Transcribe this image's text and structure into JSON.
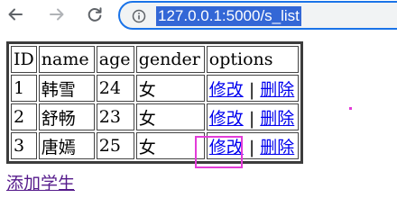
{
  "browser": {
    "url": "127.0.0.1:5000/s_list",
    "icons": {
      "back": "arrow-left-icon",
      "forward": "arrow-right-icon",
      "reload": "reload-icon",
      "site_info": "info-circle-icon"
    }
  },
  "table": {
    "headers": [
      "ID",
      "name",
      "age",
      "gender",
      "options"
    ],
    "rows": [
      {
        "id": "1",
        "name": "韩雪",
        "age": "24",
        "gender": "女",
        "edit": "修改",
        "sep": "|",
        "delete": "删除"
      },
      {
        "id": "2",
        "name": "舒畅",
        "age": "23",
        "gender": "女",
        "edit": "修改",
        "sep": "|",
        "delete": "删除"
      },
      {
        "id": "3",
        "name": "唐嫣",
        "age": "25",
        "gender": "女",
        "edit": "修改",
        "sep": "|",
        "delete": "删除"
      }
    ]
  },
  "add_student_link": "添加学生",
  "colors": {
    "highlight": "#e33bd8",
    "link": "#0000ee",
    "visited_link": "#551a8b",
    "url_selection": "#3367d6"
  }
}
